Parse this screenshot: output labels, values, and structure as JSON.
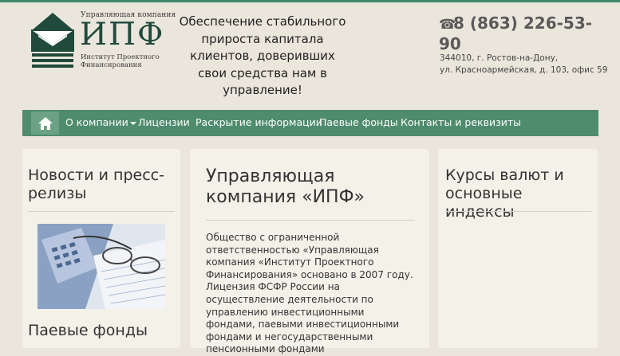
{
  "logo": {
    "small_text": "Управляющая компания",
    "big_text": "ИПФ",
    "sub_line1": "Институт Проектного",
    "sub_line2": "Финансирования"
  },
  "slogan": "Обеспечение стабильного прироста капитала клиентов, доверивших свои средства нам в управление!",
  "contacts": {
    "phone": "8 (863) 226-53-90",
    "address_line1": "344010, г. Ростов-на-Дону,",
    "address_line2": "ул. Красноармейская, д. 103,  офис 59"
  },
  "nav": {
    "items": [
      {
        "label": "О компании"
      },
      {
        "label": "Лицензии"
      },
      {
        "label": "Раскрытие информации"
      },
      {
        "label": "Паевые фонды"
      },
      {
        "label": "Контакты и реквизиты"
      }
    ]
  },
  "left": {
    "title": "Новости и пресс-релизы",
    "funds_title": "Паевые фонды"
  },
  "main": {
    "title": "Управляющая компания «ИПФ»",
    "paragraph1": "Общество с ограниченной ответственностью «Управляющая компания «Институт Проектного Финансирования» основано в 2007 году.",
    "paragraph2": "Лицензия ФСФР России на осуществление деятельности по управлению инвестиционными фондами, паевыми инвестиционными фондами и негосударственными пенсионными фондами"
  },
  "right": {
    "title": "Курсы валют и основные индексы"
  },
  "colors": {
    "nav_bg": "#4e8c6c",
    "nav_home_bg": "#6ba284",
    "logo_green": "#1f4a3c",
    "page_bg": "#ebe6dc",
    "panel_bg": "#f4f1e9"
  },
  "icons": {
    "home": "home-icon",
    "phone": "phone-icon",
    "nav_caret": "caret-down-icon"
  }
}
